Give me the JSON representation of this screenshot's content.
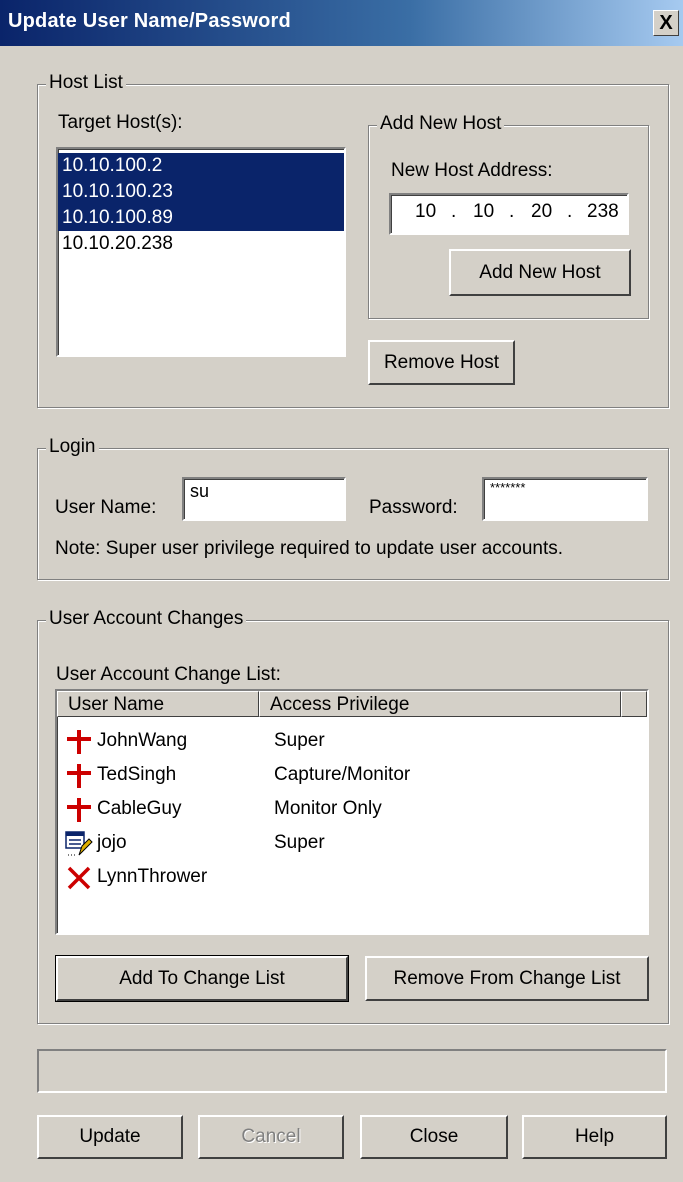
{
  "window": {
    "title": "Update User Name/Password",
    "close_label": "X"
  },
  "host_list": {
    "legend": "Host List",
    "target_label": "Target Host(s):",
    "hosts": [
      {
        "address": "10.10.100.2",
        "selected": true
      },
      {
        "address": "10.10.100.23",
        "selected": true
      },
      {
        "address": "10.10.100.89",
        "selected": true
      },
      {
        "address": "10.10.20.238",
        "selected": false
      }
    ],
    "add_new_host": {
      "legend": "Add New Host",
      "address_label": "New Host Address:",
      "octets": [
        "10",
        "10",
        "20",
        "238"
      ],
      "add_button": "Add New Host"
    },
    "remove_button": "Remove Host"
  },
  "login": {
    "legend": "Login",
    "username_label": "User Name:",
    "username_value": "su",
    "password_label": "Password:",
    "password_value": "*******",
    "note": "Note: Super user privilege required to update user accounts."
  },
  "user_account_changes": {
    "legend": "User Account Changes",
    "list_label": "User Account Change List:",
    "columns": [
      "User Name",
      "Access Privilege"
    ],
    "rows": [
      {
        "icon": "add-icon",
        "name": "JohnWang",
        "privilege": "Super"
      },
      {
        "icon": "add-icon",
        "name": "TedSingh",
        "privilege": "Capture/Monitor"
      },
      {
        "icon": "add-icon",
        "name": "CableGuy",
        "privilege": "Monitor Only"
      },
      {
        "icon": "edit-icon",
        "name": "jojo",
        "privilege": "Super"
      },
      {
        "icon": "delete-icon",
        "name": "LynnThrower",
        "privilege": ""
      }
    ],
    "add_button": "Add To Change List",
    "remove_button": "Remove From Change List"
  },
  "footer": {
    "update_button": "Update",
    "cancel_button": "Cancel",
    "close_button": "Close",
    "help_button": "Help"
  },
  "colors": {
    "selection": "#0a246a",
    "add_icon": "#cc0000",
    "delete_icon": "#cc0000"
  }
}
